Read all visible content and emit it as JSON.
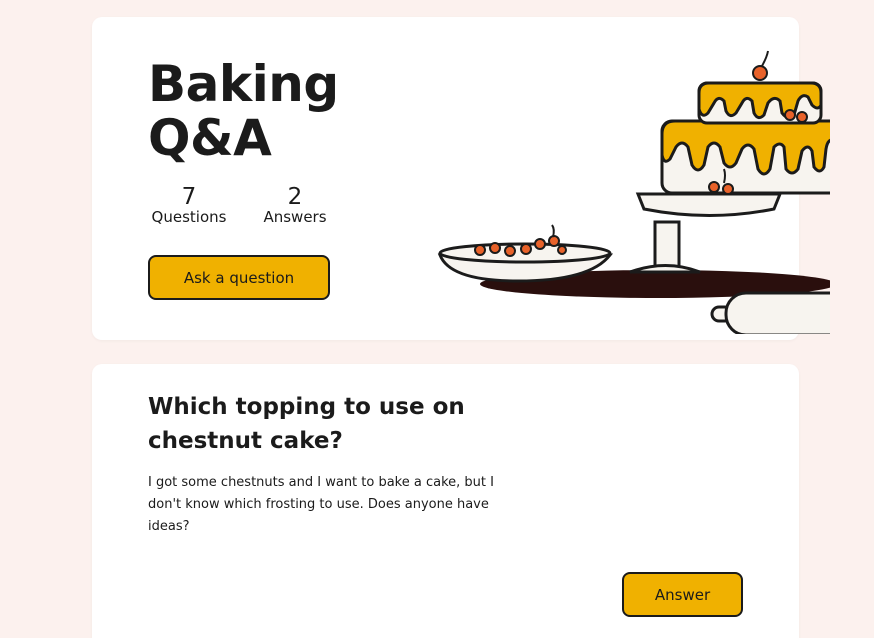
{
  "hero": {
    "title_line1": "Baking",
    "title_line2": "Q&A",
    "questions_count": "7",
    "questions_label": "Questions",
    "answers_count": "2",
    "answers_label": "Answers",
    "ask_button_label": "Ask a question",
    "illustration": "cake-on-stand-with-bowl-and-rolling-pin"
  },
  "question": {
    "title": "Which topping to use on chestnut cake?",
    "body": "I got some chestnuts and I want to bake a cake, but I don't know which frosting to use. Does anyone have ideas?",
    "answer_button_label": "Answer"
  },
  "colors": {
    "background": "#fcf1ee",
    "card": "#ffffff",
    "accent": "#f0b100",
    "berry": "#e8622a",
    "ink": "#1b1b1b",
    "cream": "#f7f4ef"
  }
}
